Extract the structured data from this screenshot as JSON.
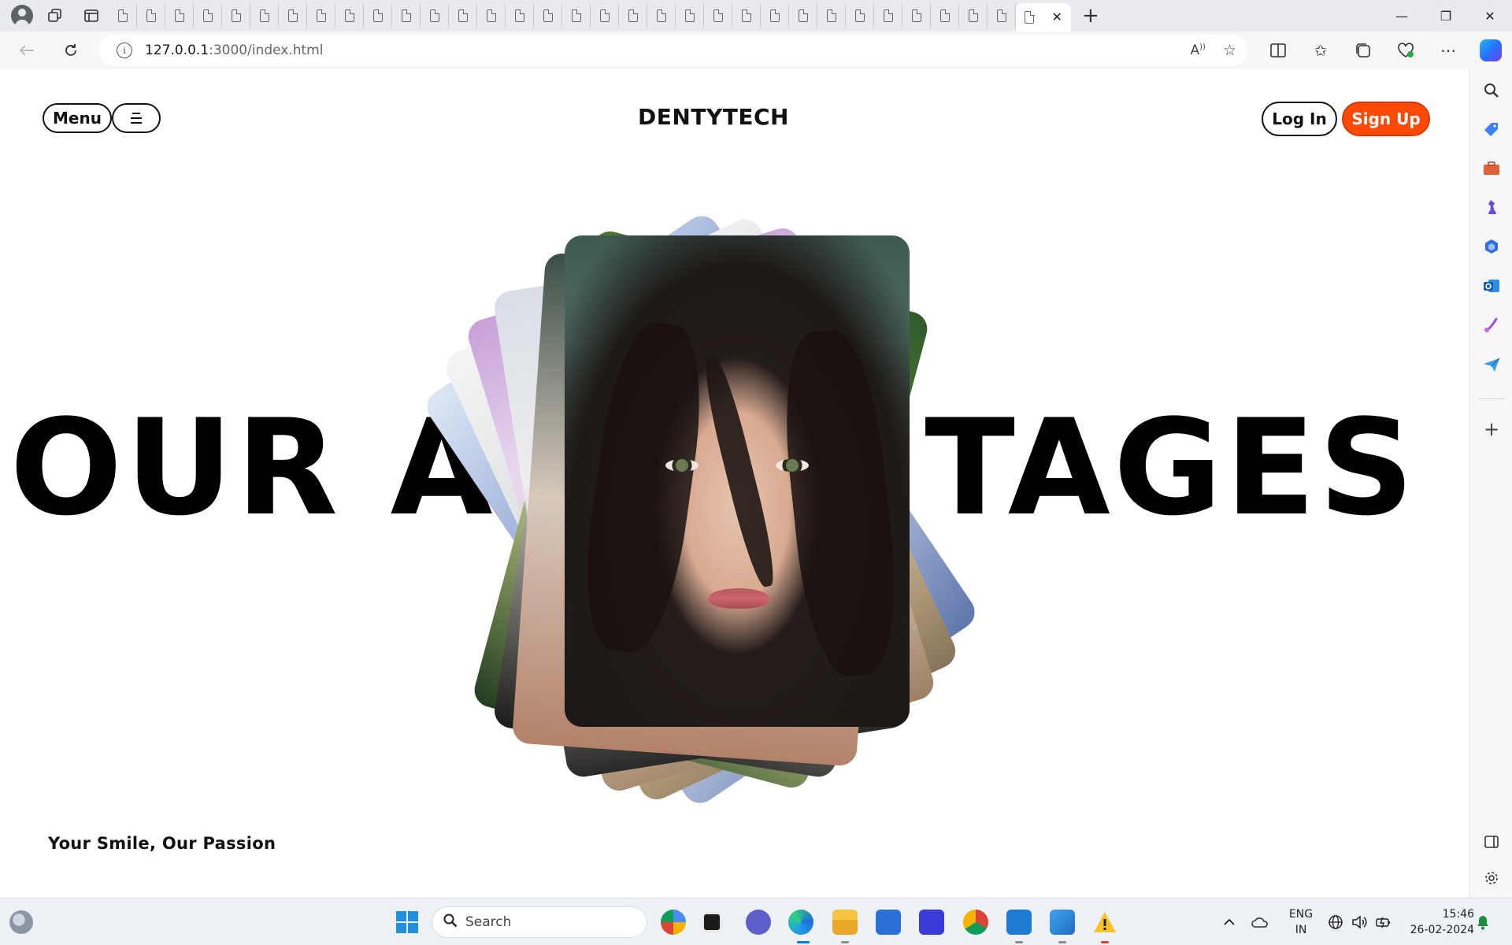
{
  "browser": {
    "address": {
      "host": "127.0.0.1",
      "rest": ":3000/index.html"
    },
    "window_controls": {
      "minimize": "—",
      "restore": "❐",
      "close": "✕"
    },
    "new_tab": "+",
    "tab_close": "✕"
  },
  "site": {
    "menu_label": "Menu",
    "brand": "DENTYTECH",
    "login_label": "Log In",
    "signup_label": "Sign Up",
    "hero_title": "OUR ADVANTAGES",
    "tagline": "Your Smile, Our Passion",
    "accent_color": "#ff4a05"
  },
  "taskbar": {
    "search_placeholder": "Search",
    "lang_line1": "ENG",
    "lang_line2": "IN",
    "time": "15:46",
    "date": "26-02-2024"
  }
}
